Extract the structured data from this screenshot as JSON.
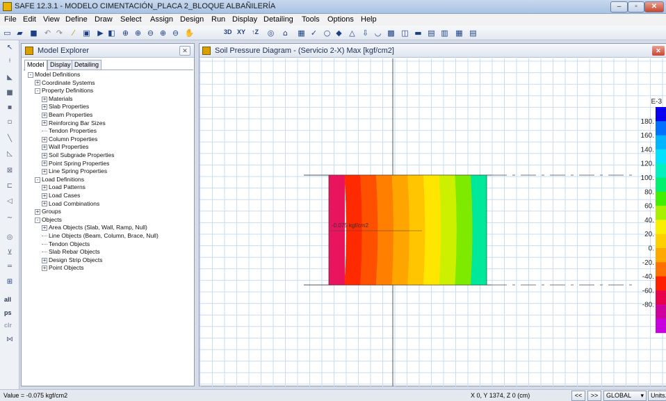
{
  "window": {
    "title": "SAFE 12.3.1 - MODELO CIMENTACIÓN_PLACA 2_BLOQUE ALBAÑILERÍA",
    "minimize": "–",
    "maximize": "▫",
    "close": "✕"
  },
  "menu": [
    "File",
    "Edit",
    "View",
    "Define",
    "Draw",
    "Select",
    "Assign",
    "Design",
    "Run",
    "Display",
    "Detailing",
    "Tools",
    "Options",
    "Help"
  ],
  "toolbar": {
    "btn_3d": "3D",
    "btn_xy": "XY",
    "btn_z": "↑Z"
  },
  "left_toolbar": {
    "all": "all",
    "ps": "ps",
    "clr": "clr"
  },
  "explorer": {
    "title": "Model Explorer",
    "close": "✕",
    "tabs": [
      "Model",
      "Display",
      "Detailing"
    ],
    "tree": [
      {
        "label": "Model Definitions",
        "level": 0,
        "node": "minus"
      },
      {
        "label": "Coordinate Systems",
        "level": 1,
        "node": "plus"
      },
      {
        "label": "Property Definitions",
        "level": 1,
        "node": "minus"
      },
      {
        "label": "Materials",
        "level": 2,
        "node": "plus"
      },
      {
        "label": "Slab Properties",
        "level": 2,
        "node": "plus"
      },
      {
        "label": "Beam Properties",
        "level": 2,
        "node": "plus"
      },
      {
        "label": "Reinforcing Bar Sizes",
        "level": 2,
        "node": "plus"
      },
      {
        "label": "Tendon Properties",
        "level": 2,
        "node": "leaf"
      },
      {
        "label": "Column Properties",
        "level": 2,
        "node": "plus"
      },
      {
        "label": "Wall Properties",
        "level": 2,
        "node": "plus"
      },
      {
        "label": "Soil Subgrade Properties",
        "level": 2,
        "node": "plus"
      },
      {
        "label": "Point Spring Properties",
        "level": 2,
        "node": "plus"
      },
      {
        "label": "Line Spring Properties",
        "level": 2,
        "node": "plus"
      },
      {
        "label": "Load Definitions",
        "level": 1,
        "node": "minus"
      },
      {
        "label": "Load Patterns",
        "level": 2,
        "node": "plus"
      },
      {
        "label": "Load Cases",
        "level": 2,
        "node": "plus"
      },
      {
        "label": "Load Combinations",
        "level": 2,
        "node": "plus"
      },
      {
        "label": "Groups",
        "level": 1,
        "node": "plus"
      },
      {
        "label": "Objects",
        "level": 1,
        "node": "minus"
      },
      {
        "label": "Area Objects (Slab, Wall, Ramp, Null)",
        "level": 2,
        "node": "plus"
      },
      {
        "label": "Line Objects (Beam, Column, Brace, Null)",
        "level": 2,
        "node": "leaf"
      },
      {
        "label": "Tendon Objects",
        "level": 2,
        "node": "leaf"
      },
      {
        "label": "Slab Rebar Objects",
        "level": 2,
        "node": "leaf"
      },
      {
        "label": "Design Strip Objects",
        "level": 2,
        "node": "plus"
      },
      {
        "label": "Point Objects",
        "level": 2,
        "node": "plus"
      }
    ]
  },
  "canvas": {
    "title": "Soil Pressure Diagram - (Servicio 2-X)  Max  [kgf/cm2]",
    "close": "✕",
    "annotation": "-0.075 kgf/cm2",
    "legend": {
      "exponent": "E-3",
      "labels": [
        "180.",
        "160.",
        "140.",
        "120.",
        "100.",
        "80.",
        "60.",
        "40.",
        "20.",
        "0.",
        "-20.",
        "-40.",
        "-60.",
        "-80."
      ],
      "colors": [
        "#0a00f0",
        "#0070ff",
        "#00b4ff",
        "#00e0ff",
        "#00f0c0",
        "#00f070",
        "#40f000",
        "#a8f000",
        "#f8f000",
        "#ffd000",
        "#ffa800",
        "#ff7000",
        "#ff2000",
        "#e8004a",
        "#d0009c",
        "#c800e0"
      ]
    },
    "contour_colors": [
      "#e8145e",
      "#ff2a00",
      "#ff5000",
      "#ff8000",
      "#ffa500",
      "#ffc600",
      "#ffe600",
      "#ccf000",
      "#7eea00",
      "#00e89a"
    ]
  },
  "status": {
    "value": "Value = -0.075 kgf/cm2",
    "coords": "X 0,  Y 1374,  Z 0  (cm)",
    "prev": "<<",
    "next": ">>",
    "coord_system": "GLOBAL",
    "units": "Units..."
  }
}
